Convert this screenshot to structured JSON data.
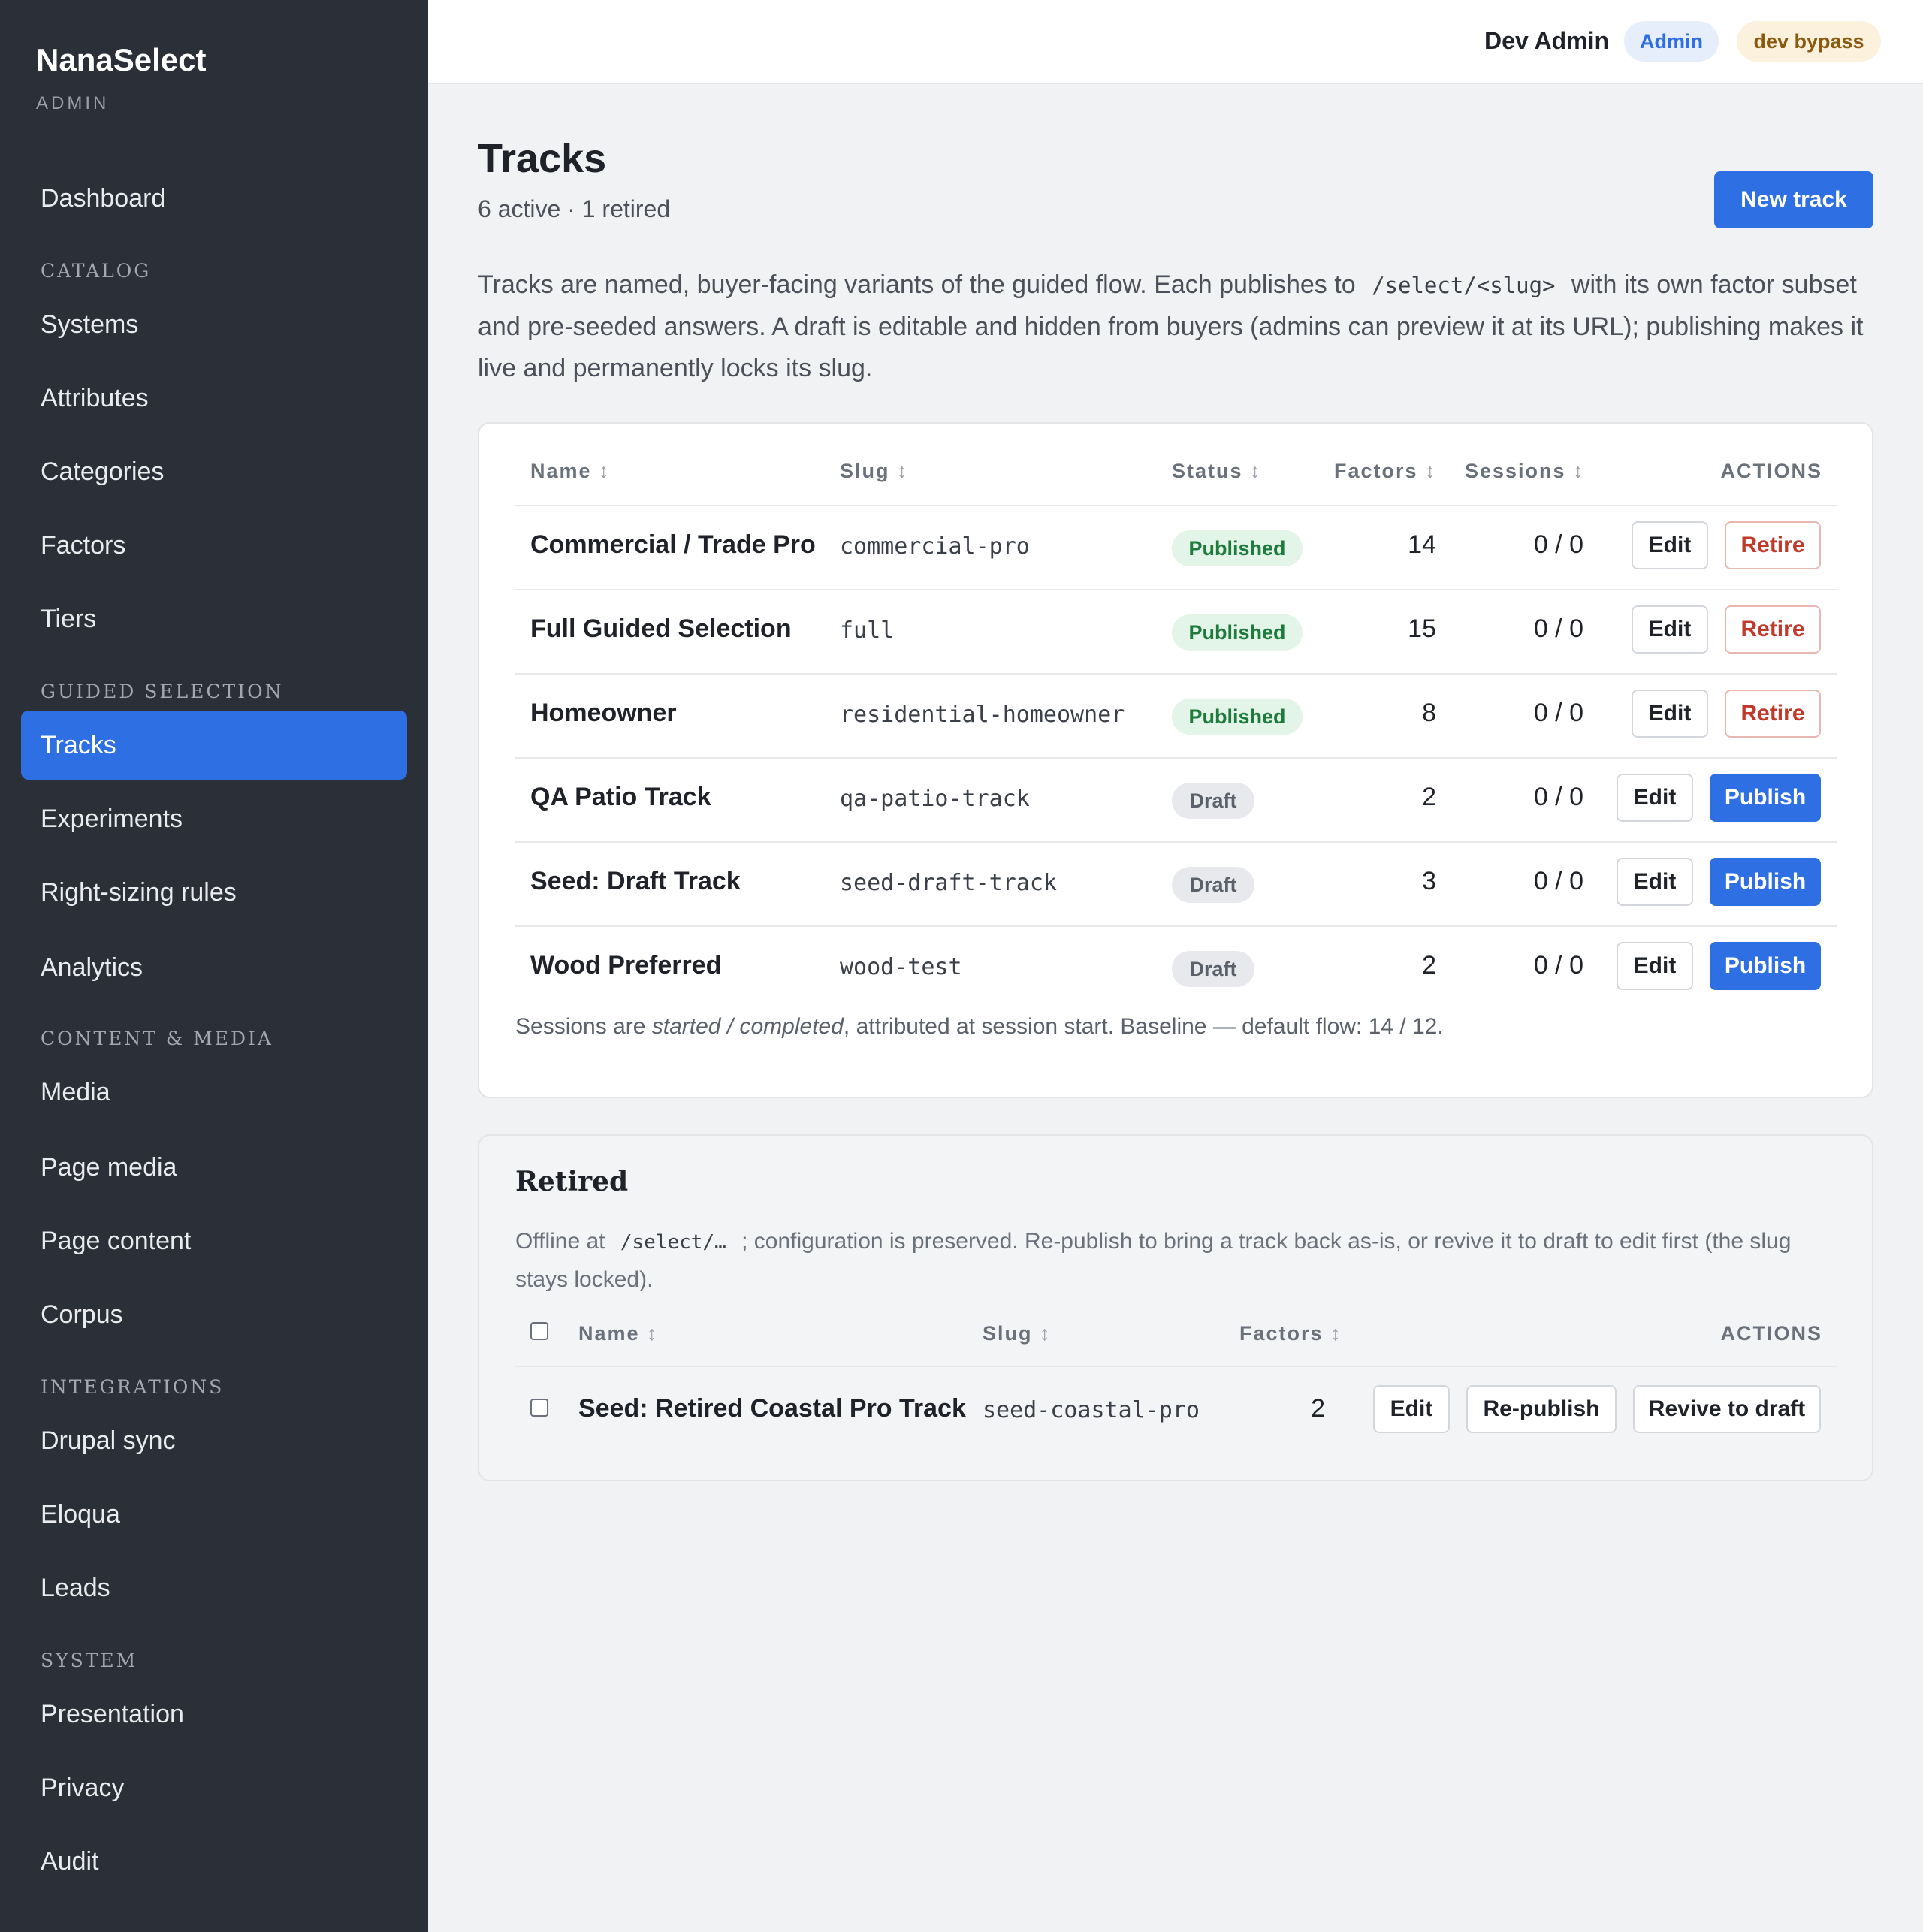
{
  "sidebar": {
    "brand": "NanaSelect",
    "brand_sub": "ADMIN",
    "dashboard": "Dashboard",
    "sections": {
      "catalog": "CATALOG",
      "guided": "GUIDED SELECTION",
      "content": "CONTENT & MEDIA",
      "integrations": "INTEGRATIONS",
      "system": "SYSTEM"
    },
    "catalog_items": [
      "Systems",
      "Attributes",
      "Categories",
      "Factors",
      "Tiers"
    ],
    "guided_items": [
      "Tracks",
      "Experiments",
      "Right-sizing rules",
      "Analytics"
    ],
    "content_items": [
      "Media",
      "Page media",
      "Page content",
      "Corpus"
    ],
    "integration_items": [
      "Drupal sync",
      "Eloqua",
      "Leads"
    ],
    "system_items": [
      "Presentation",
      "Privacy",
      "Audit"
    ],
    "active": "Tracks"
  },
  "header": {
    "user_name": "Dev Admin",
    "role_badge": "Admin",
    "bypass_badge": "dev bypass"
  },
  "page": {
    "title": "Tracks",
    "subtitle": "6 active · 1 retired",
    "new_button": "New track",
    "intro_part1": "Tracks are named, buyer-facing variants of the guided flow. Each publishes to",
    "intro_code": "/select/<slug>",
    "intro_part2": "with its own factor subset and pre-seeded answers. A draft is editable and hidden from buyers (admins can preview it at its URL); publishing makes it live and permanently locks its slug."
  },
  "active_table": {
    "headers": {
      "name": "Name",
      "slug": "Slug",
      "status": "Status",
      "factors": "Factors",
      "sessions": "Sessions",
      "actions": "ACTIONS"
    },
    "sort_glyph": "↕",
    "rows": [
      {
        "name": "Commercial / Trade Pro",
        "slug": "commercial-pro",
        "status": "Published",
        "factors": "14",
        "sessions": "0 / 0",
        "edit": "Edit",
        "action": "Retire"
      },
      {
        "name": "Full Guided Selection",
        "slug": "full",
        "status": "Published",
        "factors": "15",
        "sessions": "0 / 0",
        "edit": "Edit",
        "action": "Retire"
      },
      {
        "name": "Homeowner",
        "slug": "residential-homeowner",
        "status": "Published",
        "factors": "8",
        "sessions": "0 / 0",
        "edit": "Edit",
        "action": "Retire"
      },
      {
        "name": "QA Patio Track",
        "slug": "qa-patio-track",
        "status": "Draft",
        "factors": "2",
        "sessions": "0 / 0",
        "edit": "Edit",
        "action": "Publish"
      },
      {
        "name": "Seed: Draft Track",
        "slug": "seed-draft-track",
        "status": "Draft",
        "factors": "3",
        "sessions": "0 / 0",
        "edit": "Edit",
        "action": "Publish"
      },
      {
        "name": "Wood Preferred",
        "slug": "wood-test",
        "status": "Draft",
        "factors": "2",
        "sessions": "0 / 0",
        "edit": "Edit",
        "action": "Publish"
      }
    ],
    "footnote_pre": "Sessions are ",
    "footnote_em": "started / completed",
    "footnote_post": ", attributed at session start. Baseline — default flow: 14 / 12."
  },
  "retired": {
    "title": "Retired",
    "desc_pre": "Offline at",
    "desc_code": "/select/…",
    "desc_post": "; configuration is preserved. Re-publish to bring a track back as-is, or revive it to draft to edit first (the slug stays locked).",
    "headers": {
      "name": "Name",
      "slug": "Slug",
      "factors": "Factors",
      "actions": "ACTIONS"
    },
    "rows": [
      {
        "name": "Seed: Retired Coastal Pro Track",
        "slug": "seed-coastal-pro",
        "factors": "2",
        "edit": "Edit",
        "republish": "Re-publish",
        "revive": "Revive to draft"
      }
    ]
  },
  "colors": {
    "sidebar_bg": "#2b2f37",
    "accent": "#2f6fe4",
    "published": "#1e7b3c",
    "retire": "#c0392b"
  }
}
